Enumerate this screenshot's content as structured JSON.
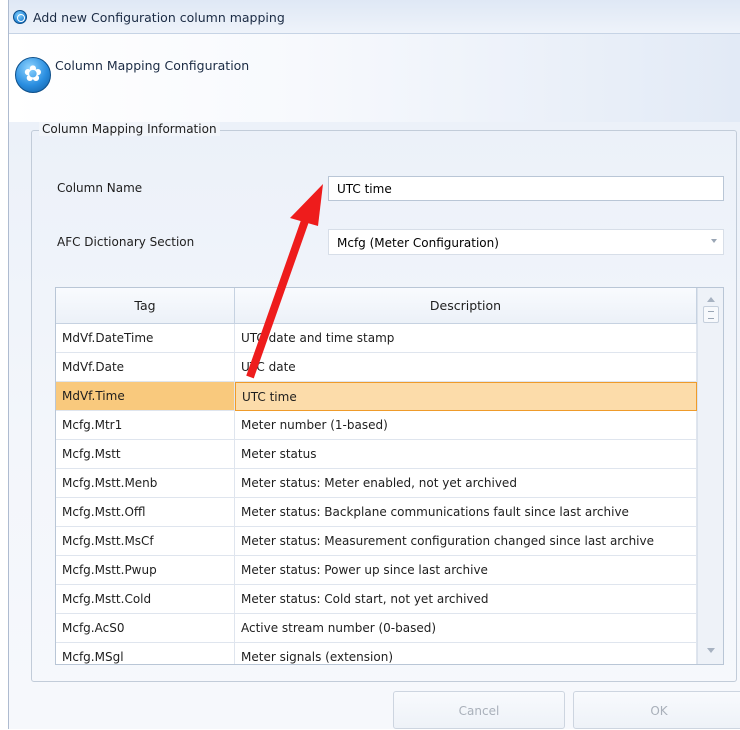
{
  "window": {
    "title": "Add new Configuration column mapping"
  },
  "header": {
    "title": "Column Mapping Configuration"
  },
  "group": {
    "legend": "Column Mapping Information"
  },
  "form": {
    "column_name_label": "Column Name",
    "column_name_value": "UTC time",
    "dictionary_label": "AFC Dictionary Section",
    "dictionary_value": "Mcfg (Meter Configuration)"
  },
  "grid": {
    "columns": [
      "Tag",
      "Description"
    ],
    "selected_row_index": 2,
    "rows": [
      {
        "tag": "MdVf.DateTime",
        "description": "UTC date and time stamp"
      },
      {
        "tag": "MdVf.Date",
        "description": "UTC date"
      },
      {
        "tag": "MdVf.Time",
        "description": "UTC time"
      },
      {
        "tag": "Mcfg.Mtr1",
        "description": "Meter number (1-based)"
      },
      {
        "tag": "Mcfg.Mstt",
        "description": "Meter status"
      },
      {
        "tag": "Mcfg.Mstt.Menb",
        "description": "Meter status: Meter enabled, not yet archived"
      },
      {
        "tag": "Mcfg.Mstt.Offl",
        "description": "Meter status: Backplane communications fault since last archive"
      },
      {
        "tag": "Mcfg.Mstt.MsCf",
        "description": "Meter status: Measurement configuration changed since last archive"
      },
      {
        "tag": "Mcfg.Mstt.Pwup",
        "description": "Meter status: Power up since last archive"
      },
      {
        "tag": "Mcfg.Mstt.Cold",
        "description": "Meter status: Cold start, not yet archived"
      },
      {
        "tag": "Mcfg.AcS0",
        "description": "Active stream number (0-based)"
      },
      {
        "tag": "Mcfg.MSgl",
        "description": "Meter signals (extension)"
      }
    ]
  },
  "buttons": {
    "cancel": "Cancel",
    "ok": "OK"
  },
  "annotation": {
    "color": "#ee1c1c"
  },
  "icons": {
    "title": "app-icon",
    "header": "runner-icon"
  }
}
